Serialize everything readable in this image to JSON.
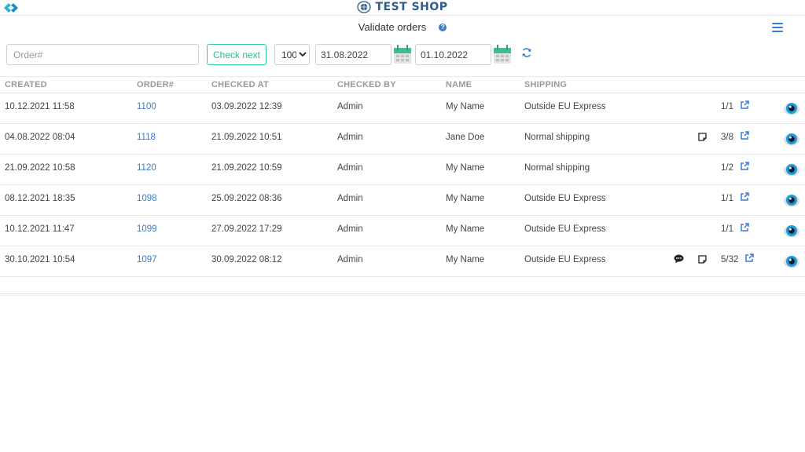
{
  "header": {
    "brand": "TEST SHOP",
    "page_title": "Validate orders",
    "help_icon": "?"
  },
  "filters": {
    "order_placeholder": "Order#",
    "check_next_label": "Check next",
    "page_size": "100",
    "date_from": "31.08.2022",
    "date_to": "01.10.2022"
  },
  "table": {
    "columns": [
      "CREATED",
      "ORDER#",
      "CHECKED AT",
      "CHECKED BY",
      "NAME",
      "SHIPPING"
    ],
    "rows": [
      {
        "created": "10.12.2021 11:58",
        "order": "1100",
        "checked_at": "03.09.2022 12:39",
        "checked_by": "Admin",
        "name": "My Name",
        "shipping": "Outside EU Express",
        "count": "1/1",
        "note": false,
        "chat": false
      },
      {
        "created": "04.08.2022 08:04",
        "order": "1118",
        "checked_at": "21.09.2022 10:51",
        "checked_by": "Admin",
        "name": "Jane Doe",
        "shipping": "Normal shipping",
        "count": "3/8",
        "note": true,
        "chat": false
      },
      {
        "created": "21.09.2022 10:58",
        "order": "1120",
        "checked_at": "21.09.2022 10:59",
        "checked_by": "Admin",
        "name": "My Name",
        "shipping": "Normal shipping",
        "count": "1/2",
        "note": false,
        "chat": false
      },
      {
        "created": "08.12.2021 18:35",
        "order": "1098",
        "checked_at": "25.09.2022 08:36",
        "checked_by": "Admin",
        "name": "My Name",
        "shipping": "Outside EU Express",
        "count": "1/1",
        "note": false,
        "chat": false
      },
      {
        "created": "10.12.2021 11:47",
        "order": "1099",
        "checked_at": "27.09.2022 17:29",
        "checked_by": "Admin",
        "name": "My Name",
        "shipping": "Outside EU Express",
        "count": "1/1",
        "note": false,
        "chat": false
      },
      {
        "created": "30.10.2021 10:54",
        "order": "1097",
        "checked_at": "30.09.2022 08:12",
        "checked_by": "Admin",
        "name": "My Name",
        "shipping": "Outside EU Express",
        "count": "5/32",
        "note": true,
        "chat": true
      }
    ]
  },
  "colors": {
    "accent_blue": "#3a7bd5",
    "accent_green": "#31c99a",
    "brand_blue": "#2d5d8f"
  },
  "icons": [
    "app-logo-icon",
    "globe-icon",
    "help-icon",
    "menu-icon",
    "calendar-icon",
    "refresh-icon",
    "note-icon",
    "chat-icon",
    "external-link-icon",
    "eye-icon"
  ]
}
